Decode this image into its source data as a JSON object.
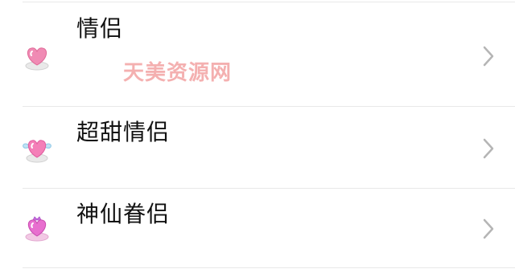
{
  "list": {
    "items": [
      {
        "title": "情侣",
        "icon": "heart-badge-icon",
        "accent": "#f08bb4"
      },
      {
        "title": "超甜情侣",
        "icon": "winged-heart-badge-icon",
        "accent": "#f47fb8"
      },
      {
        "title": "神仙眷侣",
        "icon": "crowned-heart-badge-icon",
        "accent": "#e86fcf"
      }
    ]
  },
  "watermark": "天美资源网",
  "colors": {
    "text": "#111111",
    "divider": "#e8e8e8",
    "chevron": "#b5b5b5",
    "watermark": "#f3a3a3"
  }
}
